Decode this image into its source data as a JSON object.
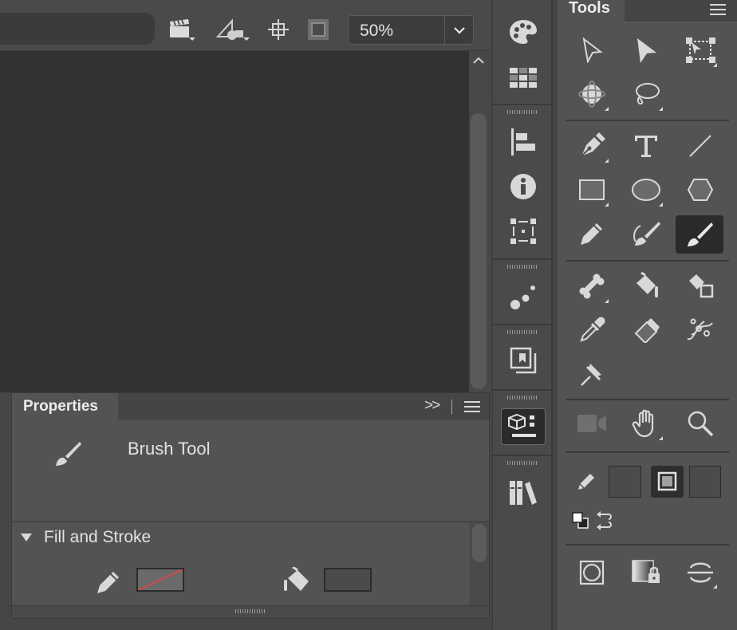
{
  "toolbar": {
    "zoom_value": "50%",
    "icons": [
      "clapperboard-icon",
      "symbol-edit-icon",
      "center-stage-icon",
      "clip-stage-icon",
      "zoom-dropdown-chevron-icon"
    ]
  },
  "properties": {
    "tab_label": "Properties",
    "expand_label": ">>",
    "tool_name": "Brush Tool",
    "section_label": "Fill and Stroke"
  },
  "tools": {
    "title": "Tools"
  },
  "colors": {
    "app_bg": "#464646",
    "stage_bg": "#323232",
    "panel_bg": "#535353",
    "active_tool_bg": "#2b2b2b",
    "no_color_slash": "#d24a4a"
  }
}
